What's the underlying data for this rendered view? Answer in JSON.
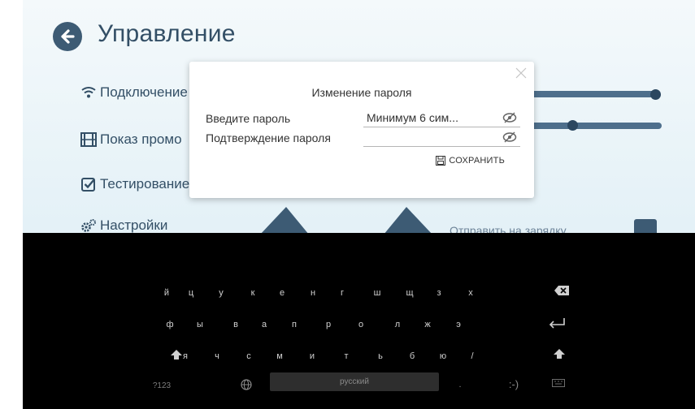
{
  "screen": {
    "title": "Управление",
    "menu": [
      {
        "label": "Подключение",
        "icon": "wifi-icon"
      },
      {
        "label": "Показ промо",
        "icon": "film-icon"
      },
      {
        "label": "Тестирование",
        "icon": "checkbox-icon"
      },
      {
        "label": "Настройки",
        "icon": "gears-icon"
      }
    ],
    "send_charge_label": "Отправить на зарядку",
    "colors": {
      "accent": "#3d5b74",
      "text": "#334f66",
      "background": "#e4f1f7"
    }
  },
  "dialog": {
    "title": "Изменение пароля",
    "password_label": "Введите пароль",
    "password_placeholder": "Минимум 6 сим...",
    "confirm_label": "Подтверждение пароля",
    "confirm_placeholder": "",
    "save_label": "СОХРАНИТЬ"
  },
  "keyboard": {
    "row1": [
      "й",
      "ц",
      "у",
      "к",
      "е",
      "н",
      "г",
      "ш",
      "щ",
      "з",
      "х"
    ],
    "row2": [
      "ф",
      "ы",
      "в",
      "а",
      "п",
      "р",
      "о",
      "л",
      "ж",
      "э"
    ],
    "row3": [
      "я",
      "ч",
      "с",
      "м",
      "и",
      "т",
      "ь",
      "б",
      "ю",
      "/"
    ],
    "mode_key": "?123",
    "space_label": "русский",
    "period_key": ".",
    "emoji_key": ":-)"
  }
}
